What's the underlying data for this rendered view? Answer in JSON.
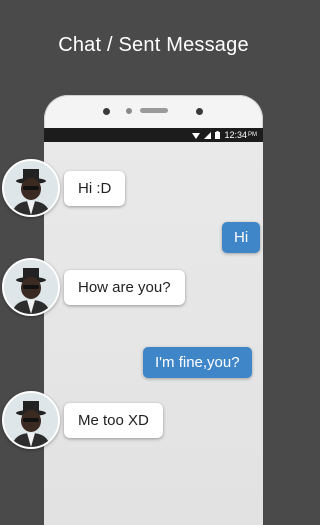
{
  "headline": "Chat / Sent Message",
  "status_bar": {
    "time": "12:34",
    "ampm": "PM"
  },
  "messages": [
    {
      "from": "contact",
      "text": "Hi :D"
    },
    {
      "from": "me",
      "text": "Hi"
    },
    {
      "from": "contact",
      "text": "How are you?"
    },
    {
      "from": "me",
      "text": "I'm fine,you?"
    },
    {
      "from": "contact",
      "text": "Me too XD"
    }
  ],
  "colors": {
    "background": "#4a4a4a",
    "sent_bubble": "#3f86c8",
    "received_bubble": "#ffffff"
  }
}
